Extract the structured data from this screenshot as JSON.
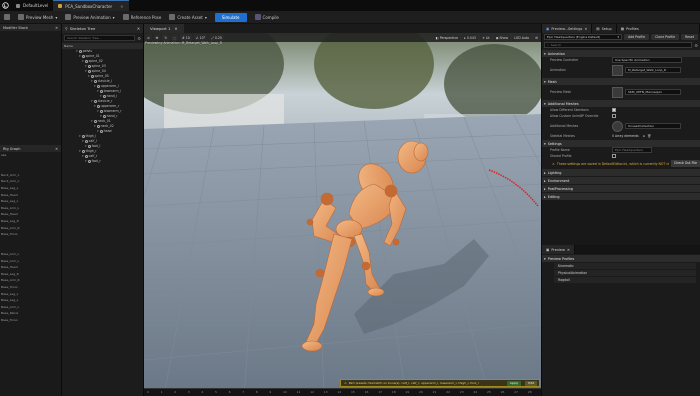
{
  "titlebar": {
    "tabs": [
      {
        "label": "DefaultLevel",
        "active": false
      },
      {
        "label": "PCA_SandboxCharacter",
        "active": true
      }
    ]
  },
  "toolbar": {
    "items": [
      "Preview Mesh",
      "Preview Animation",
      "Reference Pose",
      "Create Asset"
    ],
    "simulate": "Simulate",
    "compile": "Compile"
  },
  "left_panel": {
    "head1": "Modifier Stack",
    "head2": "Rig Graph",
    "items_top": [
      "",
      "",
      "",
      "",
      "",
      "",
      "",
      "",
      "",
      "",
      "",
      "",
      "",
      "",
      "",
      "",
      ""
    ],
    "items_bottom": [
      "abs",
      "",
      "",
      "Neck_Arm_L",
      "Neck_Arm_L",
      "Base_Leg_L",
      "Base_Head",
      "Base_Leg_L",
      "Base_Arm_L",
      "Base_Head",
      "Base_Leg_R",
      "Base_Arm_R",
      "Base_Torso",
      "",
      "",
      "Base_Arm_L",
      "Base_Arm_L",
      "Base_Head",
      "Base_Leg_R",
      "Base_Arm_R",
      "Base_Torso",
      "Base_Leg_L",
      "Base_Leg_L",
      "Base_Arm_L",
      "Base_Pelvis",
      "Base_Torso"
    ]
  },
  "skeleton": {
    "tab": "Skeleton Tree",
    "search_placeholder": "Search Skeleton Tree...",
    "column": "Name",
    "bones": [
      {
        "name": "pelvis",
        "depth": 0
      },
      {
        "name": "spine_01",
        "depth": 1
      },
      {
        "name": "spine_02",
        "depth": 2
      },
      {
        "name": "spine_03",
        "depth": 3
      },
      {
        "name": "spine_04",
        "depth": 3
      },
      {
        "name": "spine_05",
        "depth": 4
      },
      {
        "name": "clavicle_l",
        "depth": 5
      },
      {
        "name": "upperarm_l",
        "depth": 6
      },
      {
        "name": "lowerarm_l",
        "depth": 7
      },
      {
        "name": "hand_l",
        "depth": 8
      },
      {
        "name": "clavicle_r",
        "depth": 5
      },
      {
        "name": "upperarm_r",
        "depth": 6
      },
      {
        "name": "lowerarm_r",
        "depth": 7
      },
      {
        "name": "hand_r",
        "depth": 8
      },
      {
        "name": "neck_01",
        "depth": 5
      },
      {
        "name": "neck_02",
        "depth": 6
      },
      {
        "name": "head",
        "depth": 7
      },
      {
        "name": "thigh_l",
        "depth": 1
      },
      {
        "name": "calf_l",
        "depth": 2
      },
      {
        "name": "foot_l",
        "depth": 3
      },
      {
        "name": "thigh_r",
        "depth": 1
      },
      {
        "name": "calf_r",
        "depth": 2
      },
      {
        "name": "foot_r",
        "depth": 3
      }
    ]
  },
  "viewport": {
    "tab": "Viewport 1",
    "buttons": [
      "Perspective",
      "Lit",
      "Show"
    ],
    "speed": "0.043",
    "lod": "LOD Auto",
    "num1": "10",
    "num2": "10°",
    "num3": "0.25",
    "info_line": "Previewing Animation: M_Retarget_Walk_Loop_R",
    "notification": "Part presets mismatch on bone(s): calf_l, calf_r, upperarm_l, lowerarm_l, thigh_l, foot_l",
    "notif_btn1": "Apply",
    "notif_btn2": "Edit",
    "timeline_ticks": [
      "0",
      "1",
      "2",
      "3",
      "4",
      "5",
      "6",
      "7",
      "8",
      "9",
      "10",
      "11",
      "12",
      "13",
      "14",
      "15",
      "16",
      "17",
      "18",
      "19",
      "20",
      "21",
      "22",
      "23",
      "24",
      "25",
      "26",
      "27",
      "28"
    ]
  },
  "right_panel": {
    "tabs": [
      "Preview...Settings",
      "Setup",
      "Profiles"
    ],
    "profile": "Epic Headquarters (Engine Default)",
    "add_profile": "Add Profile",
    "clone_profile": "Clone Profile",
    "reset": "Reset",
    "search_placeholder": "Search",
    "sections": {
      "animation": "Animation",
      "mesh": "Mesh",
      "additional_meshes": "Additional Meshes",
      "settings": "Settings",
      "lighting": "Lighting",
      "environment": "Environment",
      "postprocessing": "PostProcessing",
      "editing": "Editing"
    },
    "animation": {
      "preview_controller_label": "Preview Controller",
      "preview_controller": "Use Specific Animation",
      "animation_label": "Animation",
      "animation_value": "M_Retarget_Walk_Loop_R"
    },
    "mesh": {
      "preview_mesh_label": "Preview Mesh",
      "preview_mesh_value": "SKM_UEFN_Mannequin"
    },
    "additional": {
      "allow_different_label": "Allow Different Skeletons",
      "allow_custom_label": "Allow Custom AnimBP Override",
      "additional_meshes_label": "Additional Meshes",
      "additional_meshes_value": "UnusedCollection",
      "skeletal_meshes_label": "Skeletal Meshes",
      "skeletal_meshes_value": "0 Array elements"
    },
    "settings": {
      "profile_name_label": "Profile Name",
      "profile_name_value": "Epic Headquarters",
      "shared_profile_label": "Shared Profile",
      "warning": "These settings are saved in DefaultEditor.ini, which is currently NOT checked out.",
      "checkout": "Check Out File"
    },
    "preview_tab": "Preview",
    "preview_profiles": "Preview Profiles",
    "profile_items": [
      "Kinematic",
      "PhysicalAnimation",
      "Ragdoll"
    ]
  },
  "colors": {
    "accent_blue": "#1f6fd0",
    "warning_yellow": "#e0b040",
    "annotation_red": "#e02020",
    "mannequin_orange": "#e8a070"
  }
}
